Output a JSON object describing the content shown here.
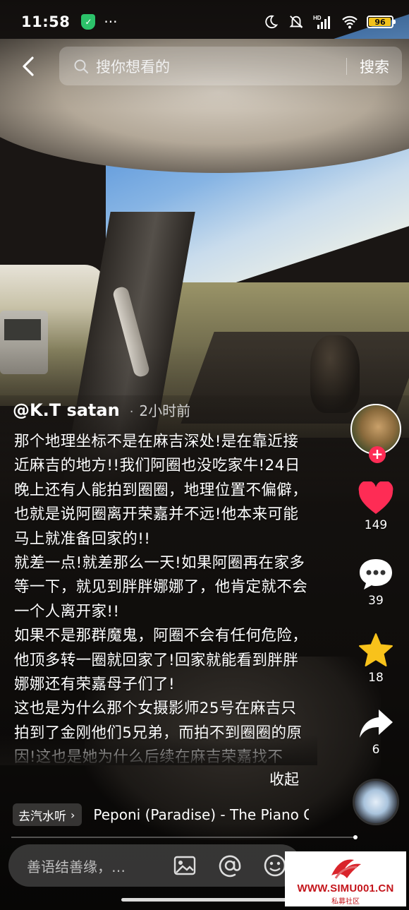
{
  "status_bar": {
    "time": "11:58",
    "battery_level": "96",
    "battery_fill_percent": 96,
    "icons": [
      "shield-icon",
      "more-dots-icon",
      "moon-icon",
      "mute-icon",
      "hd-signal-icon",
      "wifi-icon",
      "battery-icon"
    ]
  },
  "search": {
    "placeholder": "搜你想看的",
    "button": "搜索"
  },
  "post": {
    "author": "@K.T satan",
    "separator": "·",
    "time_ago": "2小时前",
    "caption_paragraphs": [
      "那个地理坐标不是在麻吉深处!是在靠近接近麻吉的地方!!我们阿圈也没吃家牛!24日晚上还有人能拍到圈圈，地理位置不偏僻，也就是说阿圈离开荣嘉并不远!他本来可能马上就准备回家的!!",
      "就差一点!就差那么一天!如果阿圈再在家多等一下，就见到胖胖娜娜了，他肯定就不会一个人离开家!!",
      "如果不是那群魔鬼，阿圈不会有任何危险，他顶多转一圈就回家了!回家就能看到胖胖娜娜还有荣嘉母子们了!",
      "这也是为什么那个女摄影师25号在麻吉只拍到了金刚他们5兄弟，而拍不到圈圈的原因!这也是她为什么后续在麻吉荣嘉找不"
    ],
    "collapse_label": "收起"
  },
  "actions": {
    "likes": "149",
    "comments": "39",
    "favorites": "18",
    "shares": "6"
  },
  "music": {
    "tag_label": "去汽水听",
    "tag_chevron": "›",
    "song_title": "Peponi (Paradise) - The Piano G"
  },
  "comment_bar": {
    "placeholder": "善语结善缘，…"
  },
  "watermark": {
    "url": "WWW.SIMU001.CN",
    "subtitle": "私募社区"
  },
  "colors": {
    "accent_red": "#fe2c55",
    "star_yellow": "#f8c21b",
    "battery_yellow": "#f2c21b",
    "shield_green": "#2cc26a",
    "watermark_red": "#c4161c"
  }
}
